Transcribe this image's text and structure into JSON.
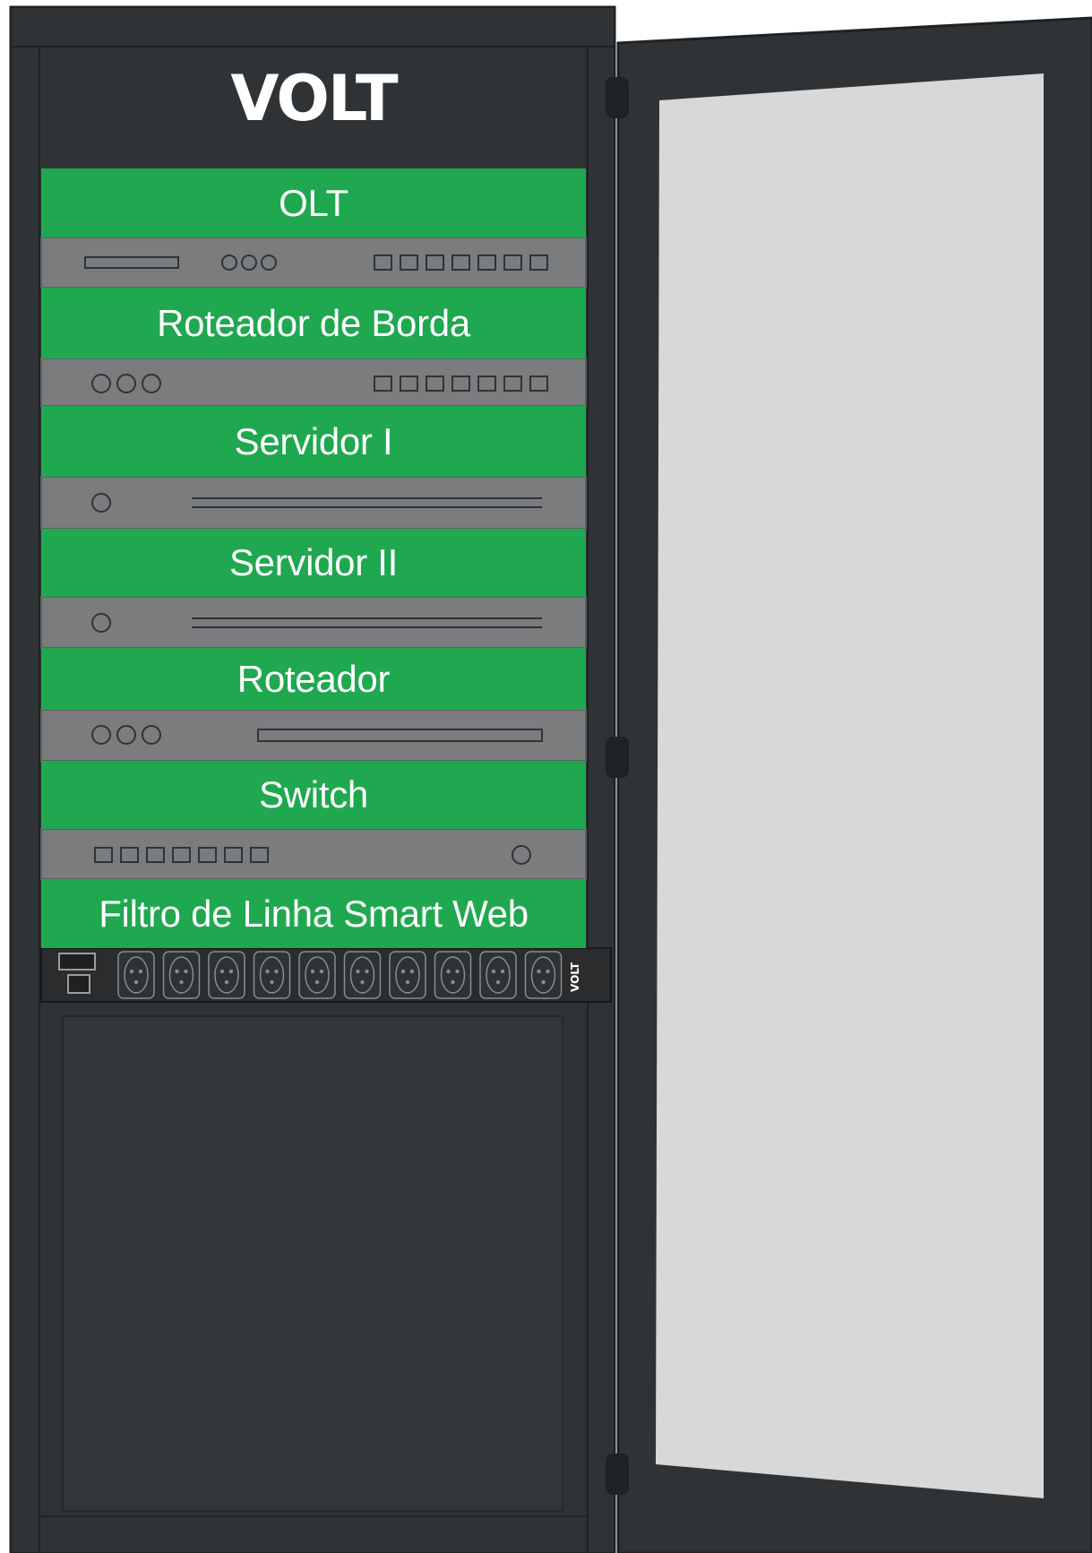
{
  "brand": {
    "logo_text": "VOLT"
  },
  "rack_units": [
    {
      "label": "OLT",
      "panel": "olt-panel"
    },
    {
      "label": "Roteador de Borda",
      "panel": "ports-panel"
    },
    {
      "label": "Servidor I",
      "panel": "server-panel"
    },
    {
      "label": "Servidor II",
      "panel": "server-panel"
    },
    {
      "label": "Roteador",
      "panel": "router-panel"
    },
    {
      "label": "Switch",
      "panel": "switch-panel"
    },
    {
      "label": "Filtro de Linha Smart Web",
      "panel": "power-strip"
    }
  ],
  "power_strip": {
    "brand_text": "VOLT",
    "outlets": 10
  },
  "colors": {
    "cabinet": "#2f3336",
    "cabinet_edge": "#1f2224",
    "label_green": "#1fa84f",
    "panel_gray": "#7a7c7e",
    "glass": "#d7d8d7"
  }
}
